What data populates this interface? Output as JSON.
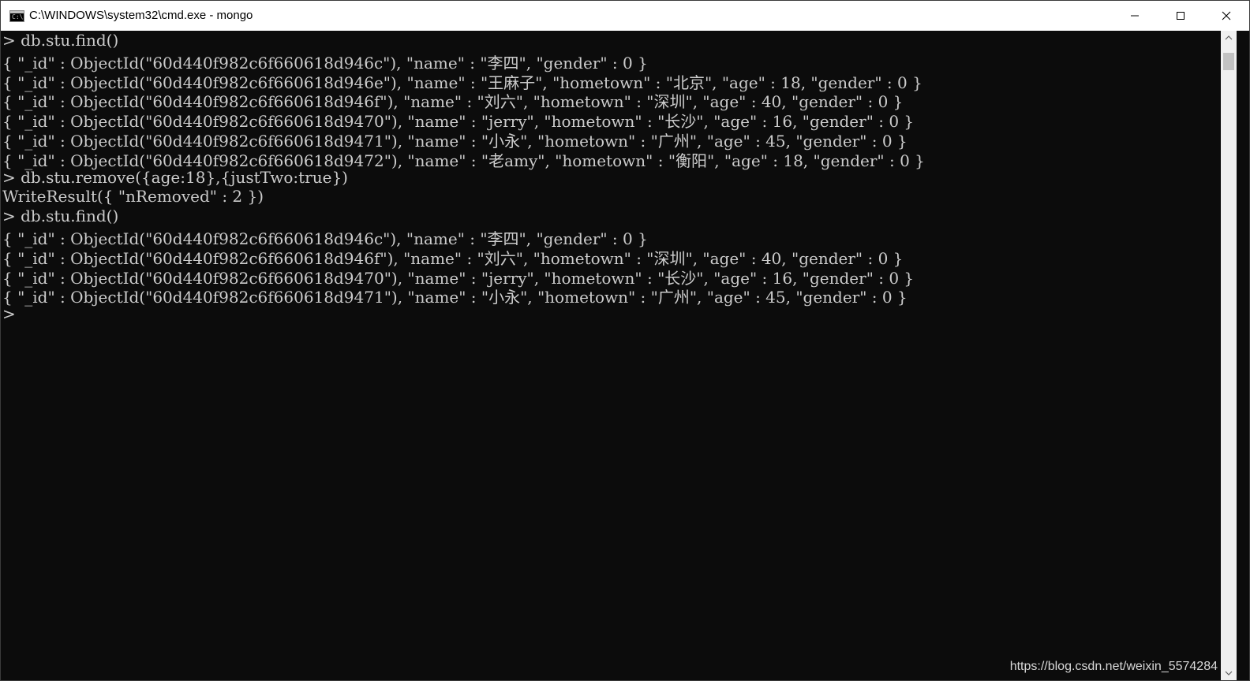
{
  "window": {
    "title": "C:\\WINDOWS\\system32\\cmd.exe - mongo",
    "icon_label": "C:\\",
    "controls": {
      "minimize": "minimize-icon",
      "maximize": "maximize-icon",
      "close": "close-icon"
    }
  },
  "console": {
    "lines": [
      "> db.stu.find()",
      "{ \"_id\" : ObjectId(\"60d440f982c6f660618d946c\"), \"name\" : \"李四\", \"gender\" : 0 }",
      "{ \"_id\" : ObjectId(\"60d440f982c6f660618d946e\"), \"name\" : \"王麻子\", \"hometown\" : \"北京\", \"age\" : 18, \"gender\" : 0 }",
      "{ \"_id\" : ObjectId(\"60d440f982c6f660618d946f\"), \"name\" : \"刘六\", \"hometown\" : \"深圳\", \"age\" : 40, \"gender\" : 0 }",
      "{ \"_id\" : ObjectId(\"60d440f982c6f660618d9470\"), \"name\" : \"jerry\", \"hometown\" : \"长沙\", \"age\" : 16, \"gender\" : 0 }",
      "{ \"_id\" : ObjectId(\"60d440f982c6f660618d9471\"), \"name\" : \"小永\", \"hometown\" : \"广州\", \"age\" : 45, \"gender\" : 0 }",
      "{ \"_id\" : ObjectId(\"60d440f982c6f660618d9472\"), \"name\" : \"老amy\", \"hometown\" : \"衡阳\", \"age\" : 18, \"gender\" : 0 }",
      "> db.stu.remove({age:18},{justTwo:true})",
      "WriteResult({ \"nRemoved\" : 2 })",
      "> db.stu.find()",
      "{ \"_id\" : ObjectId(\"60d440f982c6f660618d946c\"), \"name\" : \"李四\", \"gender\" : 0 }",
      "{ \"_id\" : ObjectId(\"60d440f982c6f660618d946f\"), \"name\" : \"刘六\", \"hometown\" : \"深圳\", \"age\" : 40, \"gender\" : 0 }",
      "{ \"_id\" : ObjectId(\"60d440f982c6f660618d9470\"), \"name\" : \"jerry\", \"hometown\" : \"长沙\", \"age\" : 16, \"gender\" : 0 }",
      "{ \"_id\" : ObjectId(\"60d440f982c6f660618d9471\"), \"name\" : \"小永\", \"hometown\" : \"广州\", \"age\" : 45, \"gender\" : 0 }",
      ">"
    ],
    "text_color": "#cccccc",
    "background": "#0c0c0c"
  },
  "watermark": "https://blog.csdn.net/weixin_5574284",
  "scrollbar": {
    "up_icon": "scroll-up-icon",
    "down_icon": "scroll-down-icon"
  }
}
